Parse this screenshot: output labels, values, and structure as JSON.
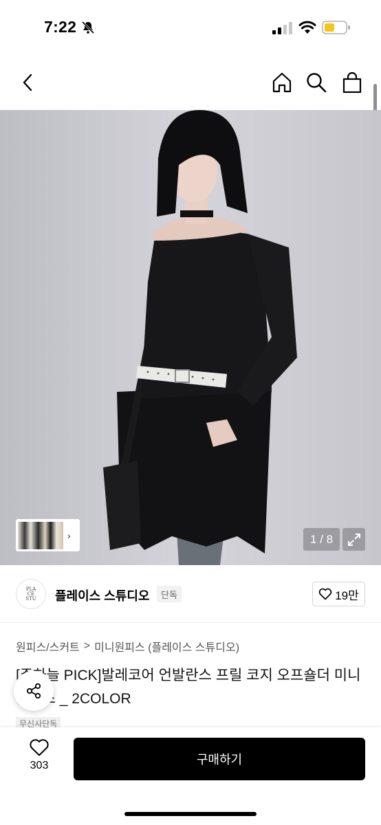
{
  "status_bar": {
    "time": "7:22"
  },
  "product": {
    "image_counter": "1 / 8",
    "brand": {
      "name": "플레이스 스튜디오",
      "badge": "단독",
      "logo_text": "PLACE STUDIO",
      "likes": "19만"
    },
    "breadcrumb": {
      "category": "원피스/스커트",
      "separator": ">",
      "subcategory": "미니원피스 (플레이스 스튜디오)"
    },
    "title": "[주하늘 PICK]발레코어 언발란스 프릴 코지 오프숄더 미니 원피스 _ 2COLOR",
    "tag": "무신사단독"
  },
  "bottom_bar": {
    "wish_count": "303",
    "buy_label": "구매하기"
  },
  "colors": {
    "accent": "#000000",
    "battery": "#f5c518"
  }
}
